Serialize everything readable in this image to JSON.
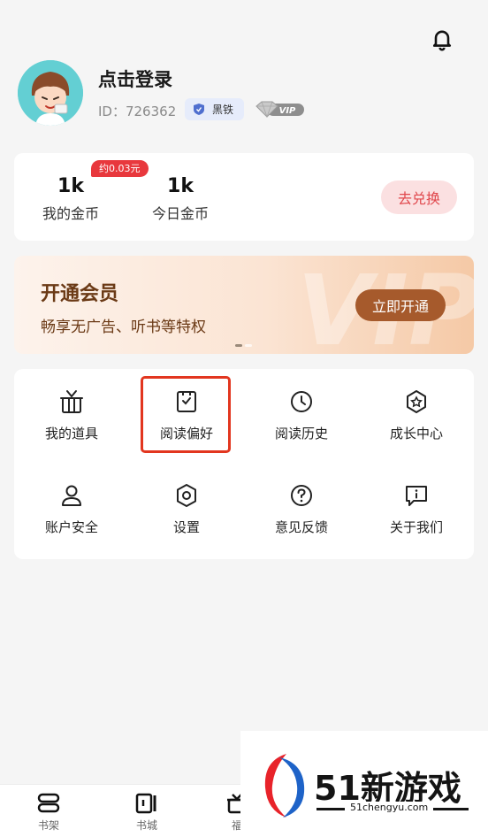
{
  "profile": {
    "login_text": "点击登录",
    "user_id": "ID：726362",
    "level_badge": "黑铁",
    "vip_badge": "VIP"
  },
  "coins": {
    "my_coins_value": "1k",
    "my_coins_label": "我的金币",
    "today_coins_value": "1k",
    "today_coins_label": "今日金币",
    "estimate_tag": "约0.03元",
    "exchange_label": "去兑换"
  },
  "vip_banner": {
    "title": "开通会员",
    "subtitle": "畅享无广告、听书等特权",
    "button_label": "立即开通",
    "watermark": "VIP"
  },
  "menu": {
    "items": [
      {
        "label": "我的道具",
        "icon": "gift-box-icon"
      },
      {
        "label": "阅读偏好",
        "icon": "reading-preference-icon"
      },
      {
        "label": "阅读历史",
        "icon": "clock-icon"
      },
      {
        "label": "成长中心",
        "icon": "growth-badge-icon"
      },
      {
        "label": "账户安全",
        "icon": "user-icon"
      },
      {
        "label": "设置",
        "icon": "settings-icon"
      },
      {
        "label": "意见反馈",
        "icon": "question-icon"
      },
      {
        "label": "关于我们",
        "icon": "info-icon"
      }
    ]
  },
  "tabbar": {
    "tabs": [
      {
        "label": "书架",
        "icon": "bookshelf-icon"
      },
      {
        "label": "书城",
        "icon": "bookstore-icon"
      },
      {
        "label": "福",
        "icon": "welfare-icon"
      }
    ]
  },
  "watermark": {
    "brand": "51新游戏",
    "url": "51chengyu.com"
  },
  "colors": {
    "accent_red": "#e8383d",
    "vip_brown": "#a65a2c",
    "highlight": "#e2361f"
  }
}
